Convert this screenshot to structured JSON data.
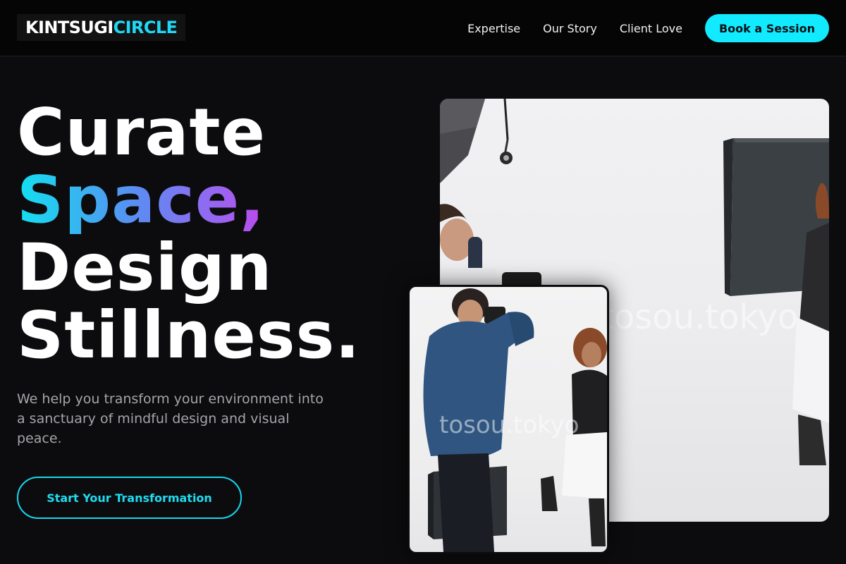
{
  "brand": {
    "logo_part1": "KINTSUGI",
    "logo_part2": "CIRCLE"
  },
  "nav": {
    "links": [
      "Expertise",
      "Our Story",
      "Client Love"
    ],
    "cta_label": "Book a Session"
  },
  "hero": {
    "headline_line1": "Curate",
    "headline_line2": "Space,",
    "headline_line3": "Design",
    "headline_line4": "Stillness.",
    "subtitle": "We help you transform your environment into a sanctuary of mindful design and visual peace.",
    "cta_label": "Start Your Transformation"
  },
  "images": {
    "main_watermark": "tosou.tokyo",
    "small_watermark": "tosou.tokyo"
  },
  "colors": {
    "accent_cyan": "#12eaff",
    "gradient_start": "#12e0f0",
    "gradient_end": "#ff00e6",
    "background": "#0c0c0e"
  }
}
